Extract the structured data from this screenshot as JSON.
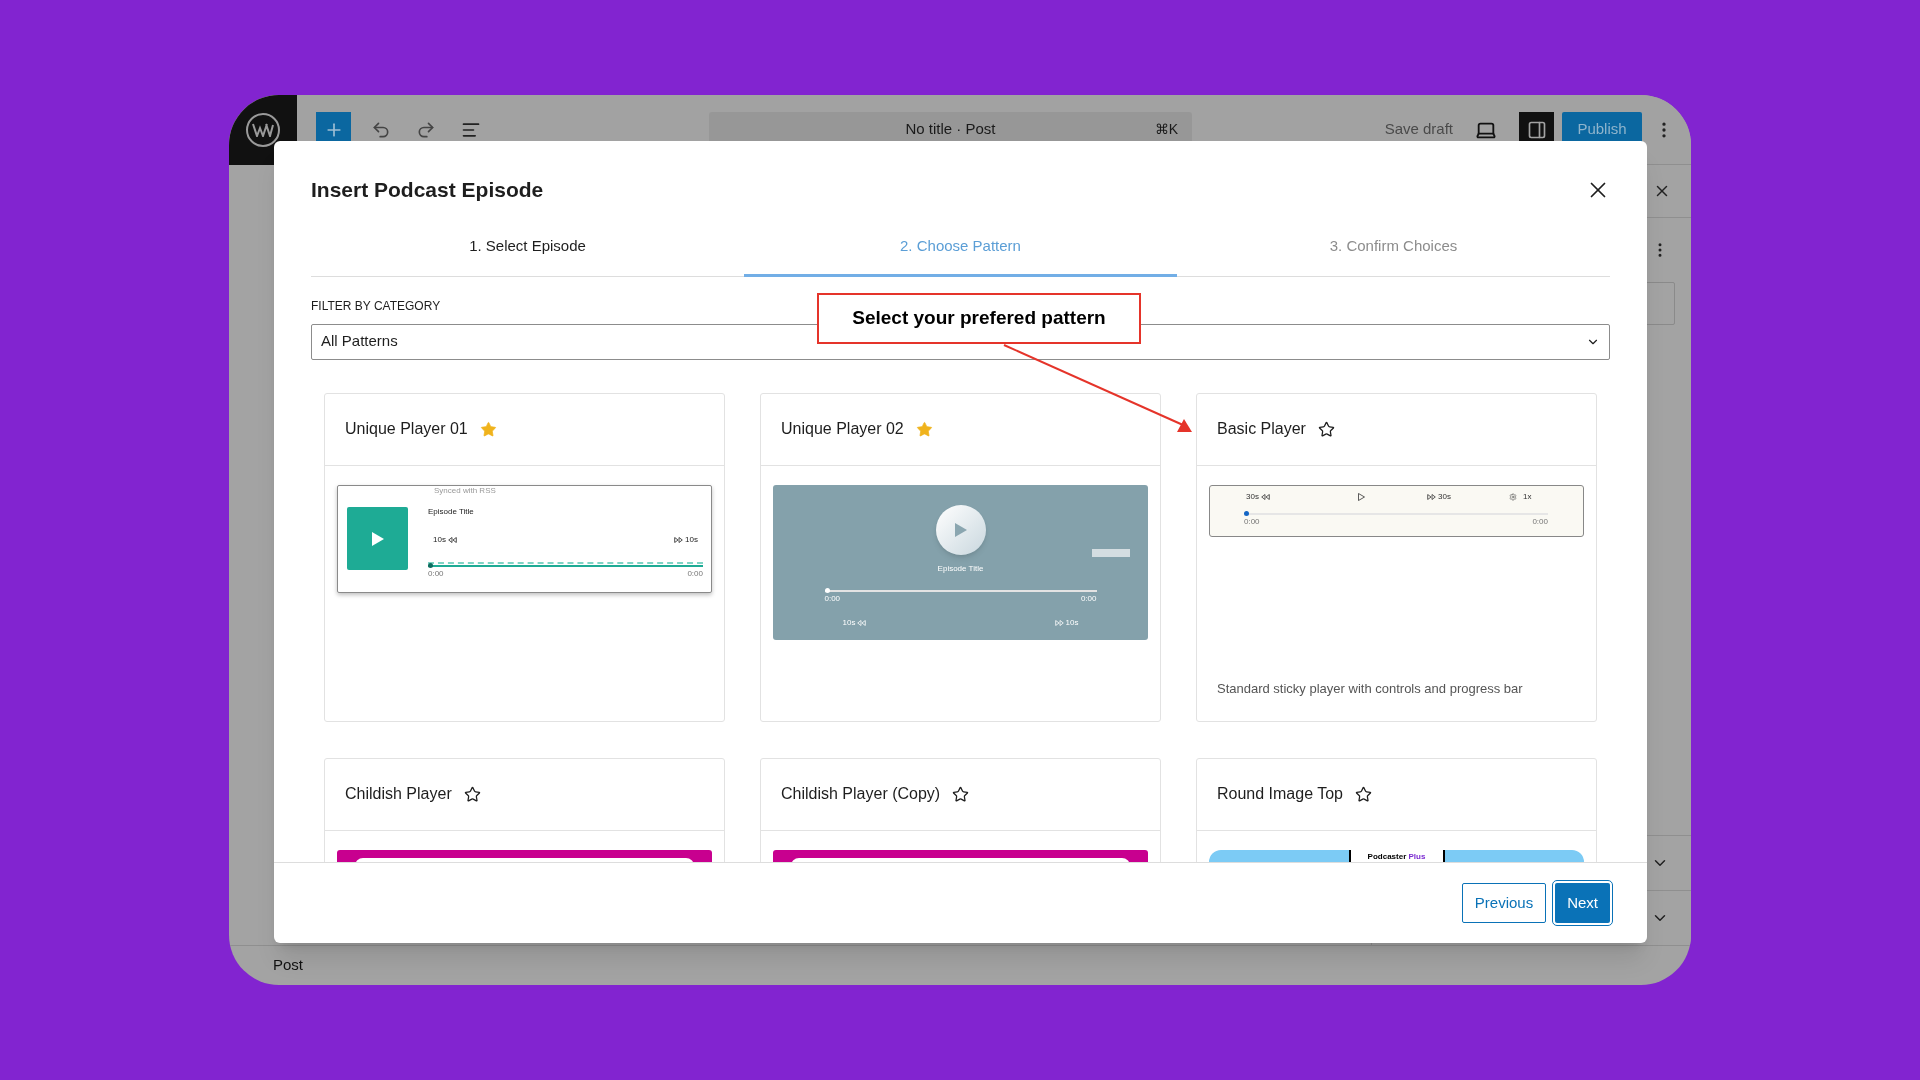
{
  "editor": {
    "toolbar": {
      "document_title": "No title · Post",
      "shortcut": "⌘K",
      "save_draft": "Save draft",
      "publish": "Publish"
    },
    "status_bar": "Post"
  },
  "modal": {
    "title": "Insert Podcast Episode",
    "tabs": [
      {
        "label": "1. Select Episode",
        "selected": false,
        "done": true
      },
      {
        "label": "2. Choose Pattern",
        "selected": true,
        "done": false
      },
      {
        "label": "3. Confirm Choices",
        "selected": false,
        "done": false
      }
    ],
    "filter": {
      "label": "FILTER BY CATEGORY",
      "value": "All Patterns"
    },
    "callout": {
      "text": "Select your prefered pattern"
    },
    "patterns": [
      {
        "name": "Unique Player 01",
        "starred": true,
        "preview": {
          "kind": "square",
          "synced": "Synced with RSS",
          "episode_title": "Episode Title",
          "back": "10s",
          "forward": "10s",
          "start": "0:00",
          "end": "0:00",
          "level": 0
        }
      },
      {
        "name": "Unique Player 02",
        "starred": true,
        "preview": {
          "kind": "circle",
          "episode_title": "Episode Title",
          "back": "10s",
          "forward": "10s",
          "start": "0:00",
          "end": "0:00",
          "level": 0
        }
      },
      {
        "name": "Basic Player",
        "starred": false,
        "description": "Standard sticky player with controls and progress bar",
        "preview": {
          "kind": "bar",
          "back": "30s",
          "forward": "30s",
          "speed": "1x",
          "start": "0:00",
          "end": "0:00",
          "level": 0
        }
      },
      {
        "name": "Childish Player",
        "starred": false,
        "preview": {
          "kind": "banner"
        }
      },
      {
        "name": "Childish Player (Copy)",
        "starred": false,
        "preview": {
          "kind": "banner"
        }
      },
      {
        "name": "Round Image Top",
        "starred": false,
        "preview": {
          "kind": "round",
          "brand": "Podcaster",
          "brand_suffix": "Plus"
        }
      }
    ],
    "buttons": [
      {
        "label": "Previous",
        "kind": "secondary"
      },
      {
        "label": "Next",
        "kind": "primary"
      }
    ]
  }
}
